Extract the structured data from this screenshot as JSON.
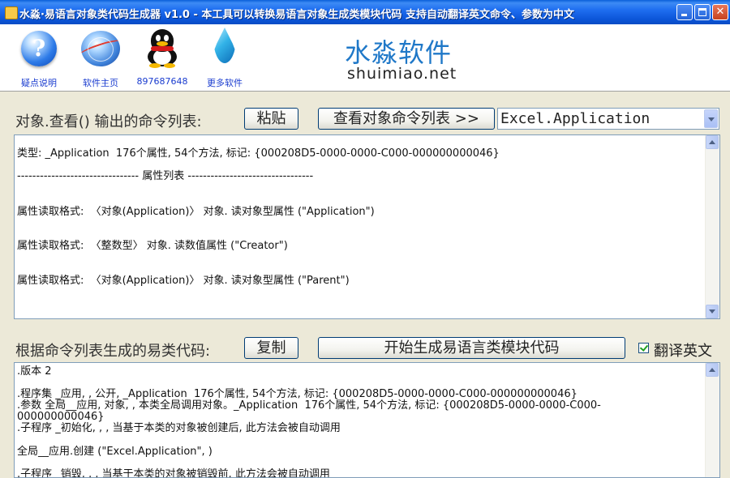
{
  "window": {
    "title": "水淼·易语言对象类代码生成器 v1.0 - 本工具可以转换易语言对象生成类模块代码 支持自动翻译英文命令、参数为中文"
  },
  "toolbar": {
    "items": [
      {
        "label": "疑点说明",
        "icon": "help-icon"
      },
      {
        "label": "软件主页",
        "icon": "globe-icon"
      },
      {
        "label": "897687648",
        "icon": "qq-penguin-icon"
      },
      {
        "label": "更多软件",
        "icon": "water-drop-icon"
      }
    ]
  },
  "brand": {
    "name_cn": "水淼软件",
    "name_en": "shuimiao.net",
    "color": "#1f78c8"
  },
  "section1": {
    "label": "对象.查看() 输出的命令列表:",
    "paste_button": "粘贴",
    "view_button": "查看对象命令列表 >>",
    "combo_value": "Excel.Application",
    "lines": [
      "类型: _Application  176个属性, 54个方法, 标记: {000208D5-0000-0000-C000-000000000046}",
      "-------------------------------- 属性列表 ---------------------------------",
      "属性读取格式:  〈对象(Application)〉 对象. 读对象型属性 (\"Application\")",
      "属性读取格式:  〈整数型〉 对象. 读数值属性 (\"Creator\")",
      "属性读取格式:  〈对象(Application)〉 对象. 读对象型属性 (\"Parent\")"
    ]
  },
  "section2": {
    "label": "根据命令列表生成的易类代码:",
    "copy_button": "复制",
    "generate_button": "开始生成易语言类模块代码",
    "translate_checkbox_label": "翻译英文",
    "translate_checked": true,
    "lines": [
      ".版本 2",
      ".程序集 _应用, , 公开, _Application  176个属性, 54个方法, 标记: {000208D5-0000-0000-C000-000000000046}",
      ".参数 全局__应用, 对象, , 本类全局调用对象。_Application  176个属性, 54个方法, 标记: {000208D5-0000-0000-C000-",
      "000000000046}",
      ".子程序 _初始化, , , 当基于本类的对象被创建后, 此方法会被自动调用",
      "全局__应用.创建 (\"Excel.Application\", )",
      ".子程序 _销毁, , , 当基于本类的对象被销毁前, 此方法会被自动调用"
    ]
  }
}
